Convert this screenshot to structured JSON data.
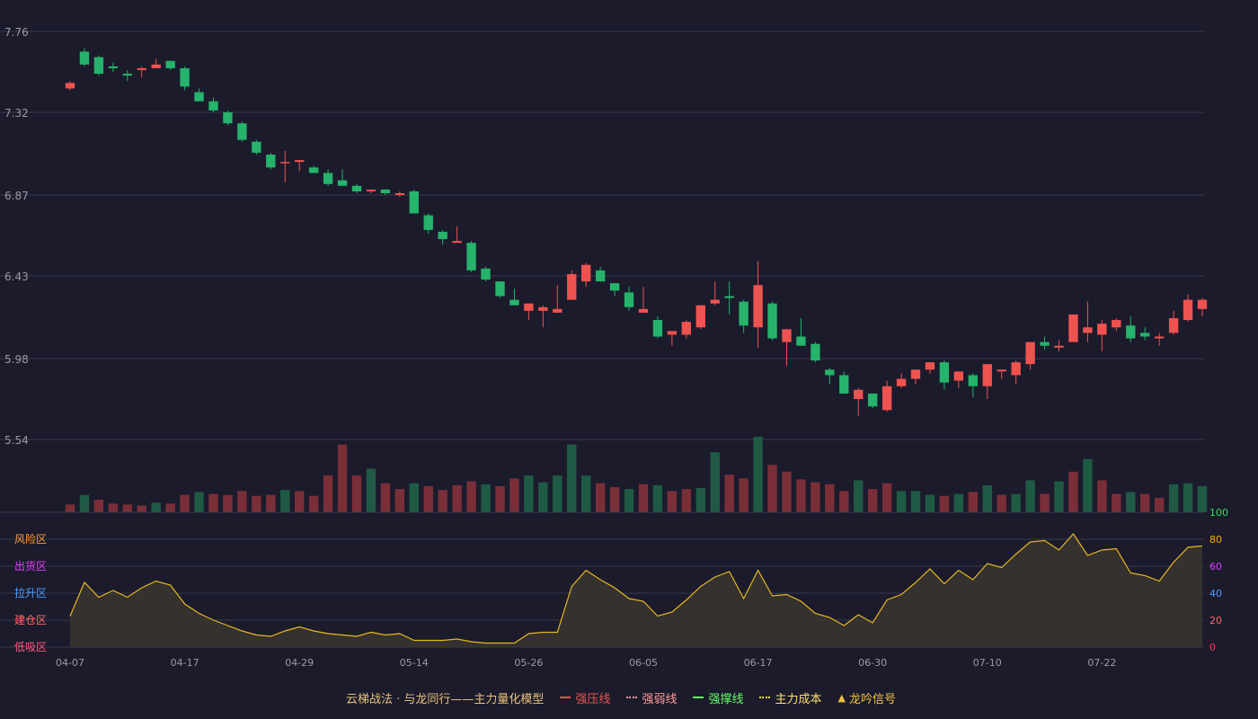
{
  "colors": {
    "up": "#ef5350",
    "down": "#26b36b",
    "vol_up": "#7a2f38",
    "vol_down": "#1f5a44",
    "grid": "#3a3a50",
    "axis_text": "#9a9aa8",
    "line": "#e6b820",
    "band_fill": "#3a3530"
  },
  "legend": {
    "title": "云梯战法 · 与龙同行——主力量化模型",
    "items": [
      {
        "label": "强压线",
        "color": "#ef5350",
        "style": "solid"
      },
      {
        "label": "强弱线",
        "color": "#ff9a9a",
        "style": "dotted"
      },
      {
        "label": "强撑线",
        "color": "#66ff66",
        "style": "solid"
      },
      {
        "label": "主力成本",
        "color": "#ffe066",
        "style": "dotted"
      },
      {
        "label": "龙吟信号",
        "color": "#f0c040",
        "style": "triangle"
      }
    ]
  },
  "chart_data": [
    {
      "type": "candlestick",
      "y_ticks": [
        "7.76",
        "7.32",
        "6.87",
        "6.43",
        "5.98",
        "5.54"
      ],
      "ylim": [
        5.54,
        7.76
      ],
      "x_ticks": [
        {
          "label": "04-07",
          "index": 0
        },
        {
          "label": "04-17",
          "index": 8
        },
        {
          "label": "04-29",
          "index": 16
        },
        {
          "label": "05-14",
          "index": 24
        },
        {
          "label": "05-26",
          "index": 32
        },
        {
          "label": "06-05",
          "index": 40
        },
        {
          "label": "06-17",
          "index": 48
        },
        {
          "label": "06-30",
          "index": 56
        },
        {
          "label": "07-10",
          "index": 64
        },
        {
          "label": "07-22",
          "index": 72
        }
      ],
      "ohlc": [
        [
          7.45,
          7.49,
          7.44,
          7.48
        ],
        [
          7.65,
          7.67,
          7.57,
          7.58
        ],
        [
          7.62,
          7.63,
          7.52,
          7.53
        ],
        [
          7.57,
          7.59,
          7.54,
          7.56
        ],
        [
          7.53,
          7.55,
          7.49,
          7.52
        ],
        [
          7.55,
          7.57,
          7.51,
          7.56
        ],
        [
          7.56,
          7.61,
          7.56,
          7.58
        ],
        [
          7.6,
          7.6,
          7.55,
          7.56
        ],
        [
          7.56,
          7.57,
          7.44,
          7.46
        ],
        [
          7.43,
          7.45,
          7.38,
          7.38
        ],
        [
          7.38,
          7.4,
          7.32,
          7.33
        ],
        [
          7.32,
          7.33,
          7.25,
          7.26
        ],
        [
          7.26,
          7.27,
          7.16,
          7.17
        ],
        [
          7.16,
          7.17,
          7.09,
          7.1
        ],
        [
          7.09,
          7.1,
          7.01,
          7.02
        ],
        [
          7.05,
          7.11,
          6.94,
          7.05
        ],
        [
          7.05,
          7.06,
          7.0,
          7.06
        ],
        [
          7.02,
          7.03,
          6.99,
          6.99
        ],
        [
          6.99,
          7.01,
          6.92,
          6.93
        ],
        [
          6.95,
          7.01,
          6.92,
          6.92
        ],
        [
          6.92,
          6.93,
          6.88,
          6.89
        ],
        [
          6.89,
          6.9,
          6.88,
          6.9
        ],
        [
          6.9,
          6.9,
          6.87,
          6.88
        ],
        [
          6.87,
          6.89,
          6.86,
          6.88
        ],
        [
          6.89,
          6.9,
          6.77,
          6.77
        ],
        [
          6.76,
          6.77,
          6.66,
          6.68
        ],
        [
          6.67,
          6.68,
          6.6,
          6.63
        ],
        [
          6.61,
          6.7,
          6.61,
          6.62
        ],
        [
          6.61,
          6.62,
          6.45,
          6.46
        ],
        [
          6.47,
          6.48,
          6.4,
          6.41
        ],
        [
          6.4,
          6.4,
          6.31,
          6.32
        ],
        [
          6.3,
          6.36,
          6.27,
          6.27
        ],
        [
          6.24,
          6.28,
          6.19,
          6.28
        ],
        [
          6.24,
          6.27,
          6.15,
          6.26
        ],
        [
          6.23,
          6.38,
          6.23,
          6.25
        ],
        [
          6.3,
          6.46,
          6.3,
          6.44
        ],
        [
          6.4,
          6.5,
          6.37,
          6.49
        ],
        [
          6.46,
          6.48,
          6.4,
          6.4
        ],
        [
          6.39,
          6.39,
          6.32,
          6.35
        ],
        [
          6.34,
          6.37,
          6.24,
          6.26
        ],
        [
          6.23,
          6.37,
          6.23,
          6.25
        ],
        [
          6.19,
          6.21,
          6.09,
          6.1
        ],
        [
          6.11,
          6.13,
          6.05,
          6.13
        ],
        [
          6.11,
          6.19,
          6.09,
          6.18
        ],
        [
          6.15,
          6.27,
          6.14,
          6.27
        ],
        [
          6.28,
          6.4,
          6.27,
          6.3
        ],
        [
          6.32,
          6.4,
          6.22,
          6.31
        ],
        [
          6.29,
          6.3,
          6.12,
          6.16
        ],
        [
          6.15,
          6.51,
          6.04,
          6.38
        ],
        [
          6.28,
          6.29,
          6.08,
          6.09
        ],
        [
          6.07,
          6.14,
          5.94,
          6.14
        ],
        [
          6.1,
          6.2,
          6.05,
          6.05
        ],
        [
          6.06,
          6.07,
          5.96,
          5.97
        ],
        [
          5.92,
          5.93,
          5.84,
          5.89
        ],
        [
          5.89,
          5.91,
          5.79,
          5.79
        ],
        [
          5.76,
          5.82,
          5.67,
          5.81
        ],
        [
          5.79,
          5.79,
          5.71,
          5.72
        ],
        [
          5.7,
          5.86,
          5.69,
          5.83
        ],
        [
          5.83,
          5.9,
          5.82,
          5.87
        ],
        [
          5.87,
          5.91,
          5.84,
          5.92
        ],
        [
          5.92,
          5.96,
          5.9,
          5.96
        ],
        [
          5.96,
          5.97,
          5.81,
          5.85
        ],
        [
          5.86,
          5.89,
          5.82,
          5.91
        ],
        [
          5.89,
          5.9,
          5.77,
          5.83
        ],
        [
          5.83,
          5.95,
          5.76,
          5.95
        ],
        [
          5.91,
          5.92,
          5.87,
          5.92
        ],
        [
          5.89,
          5.97,
          5.84,
          5.96
        ],
        [
          5.95,
          6.07,
          5.92,
          6.07
        ],
        [
          6.07,
          6.1,
          6.03,
          6.05
        ],
        [
          6.04,
          6.08,
          6.02,
          6.05
        ],
        [
          6.07,
          6.22,
          6.07,
          6.22
        ],
        [
          6.12,
          6.29,
          6.07,
          6.15
        ],
        [
          6.11,
          6.19,
          6.02,
          6.17
        ],
        [
          6.15,
          6.2,
          6.13,
          6.19
        ],
        [
          6.16,
          6.21,
          6.07,
          6.09
        ],
        [
          6.12,
          6.15,
          6.08,
          6.1
        ],
        [
          6.09,
          6.12,
          6.05,
          6.1
        ],
        [
          6.12,
          6.24,
          6.11,
          6.2
        ],
        [
          6.19,
          6.33,
          6.18,
          6.3
        ],
        [
          6.25,
          6.31,
          6.21,
          6.3
        ]
      ]
    },
    {
      "type": "bar",
      "title": "volume",
      "values": [
        8,
        18,
        13,
        9,
        8,
        7,
        10,
        9,
        18,
        21,
        19,
        18,
        22,
        17,
        18,
        23,
        22,
        17,
        38,
        70,
        38,
        45,
        30,
        24,
        30,
        27,
        23,
        28,
        32,
        29,
        27,
        35,
        38,
        31,
        38,
        70,
        38,
        30,
        26,
        24,
        29,
        28,
        22,
        24,
        25,
        62,
        39,
        35,
        78,
        49,
        42,
        34,
        31,
        29,
        22,
        33,
        24,
        30,
        22,
        22,
        18,
        17,
        19,
        21,
        28,
        18,
        19,
        33,
        19,
        32,
        42,
        55,
        33,
        19,
        21,
        19,
        15,
        29,
        30,
        27
      ],
      "directions": [
        "u",
        "d",
        "u",
        "u",
        "u",
        "u",
        "d",
        "u",
        "u",
        "d",
        "u",
        "u",
        "u",
        "u",
        "u",
        "d",
        "u",
        "u",
        "u",
        "u",
        "u",
        "d",
        "u",
        "u",
        "d",
        "u",
        "u",
        "u",
        "u",
        "d",
        "u",
        "u",
        "d",
        "d",
        "d",
        "d",
        "d",
        "u",
        "u",
        "d",
        "u",
        "d",
        "u",
        "u",
        "d",
        "d",
        "u",
        "u",
        "d",
        "u",
        "u",
        "u",
        "u",
        "u",
        "u",
        "d",
        "u",
        "u",
        "d",
        "d",
        "d",
        "u",
        "d",
        "u",
        "d",
        "u",
        "d",
        "d",
        "u",
        "d",
        "u",
        "d",
        "u",
        "u",
        "d",
        "u",
        "u",
        "d",
        "d",
        "d"
      ]
    },
    {
      "type": "area",
      "y_ticks": [
        "100",
        "80",
        "60",
        "40",
        "20",
        "0"
      ],
      "ylim": [
        0,
        100
      ],
      "zone_labels": [
        {
          "label": "风险区",
          "color": "#ff9a3a"
        },
        {
          "label": "出货区",
          "color": "#e040fb"
        },
        {
          "label": "拉升区",
          "color": "#4f9dff"
        },
        {
          "label": "建仓区",
          "color": "#ff6b6b"
        },
        {
          "label": "低吸区",
          "color": "#ff5a7a"
        }
      ],
      "tick_colors": [
        "#33dd55",
        "#ffb000",
        "#e040fb",
        "#4f9dff",
        "#ff6b6b",
        "#ff3355"
      ],
      "values": [
        23,
        48,
        37,
        42,
        37,
        44,
        49,
        46,
        32,
        25,
        20,
        16,
        12,
        9,
        8,
        12,
        15,
        12,
        10,
        9,
        8,
        11,
        9,
        10,
        5,
        5,
        5,
        6,
        4,
        3,
        3,
        3,
        10,
        11,
        11,
        45,
        57,
        50,
        44,
        36,
        34,
        23,
        26,
        35,
        45,
        52,
        56,
        36,
        57,
        38,
        39,
        34,
        25,
        22,
        16,
        24,
        18,
        35,
        39,
        48,
        58,
        47,
        57,
        50,
        62,
        59,
        69,
        78,
        79,
        72,
        84,
        68,
        72,
        73,
        55,
        53,
        49,
        63,
        74,
        75
      ]
    }
  ]
}
